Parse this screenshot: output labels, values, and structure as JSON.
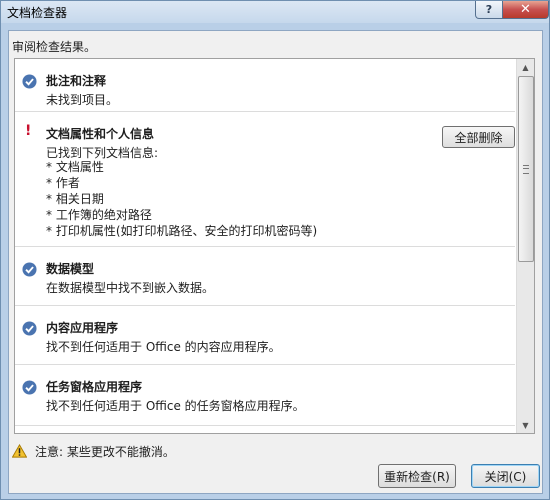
{
  "window": {
    "title": "文档检查器",
    "help_label": "?",
    "close_label": "✕"
  },
  "heading": "审阅检查结果。",
  "items": [
    {
      "status": "ok",
      "title": "批注和注释",
      "description": "未找到项目。"
    },
    {
      "status": "warning",
      "title": "文档属性和个人信息",
      "description": "已找到下列文档信息:",
      "details": [
        "* 文档属性",
        "* 作者",
        "* 相关日期",
        "* 工作簿的绝对路径",
        "* 打印机属性(如打印机路径、安全的打印机密码等)"
      ],
      "action_label": "全部删除"
    },
    {
      "status": "ok",
      "title": "数据模型",
      "description": "在数据模型中找不到嵌入数据。"
    },
    {
      "status": "ok",
      "title": "内容应用程序",
      "description": "找不到任何适用于 Office 的内容应用程序。"
    },
    {
      "status": "ok",
      "title": "任务窗格应用程序",
      "description": "找不到任何适用于 Office 的任务窗格应用程序。"
    }
  ],
  "note": "注意: 某些更改不能撤消。",
  "buttons": {
    "reinspect": "重新检查(R)",
    "close": "关闭(C)"
  },
  "colors": {
    "check_circle": "#4a74b0",
    "warning_mark": "#c8102e"
  }
}
